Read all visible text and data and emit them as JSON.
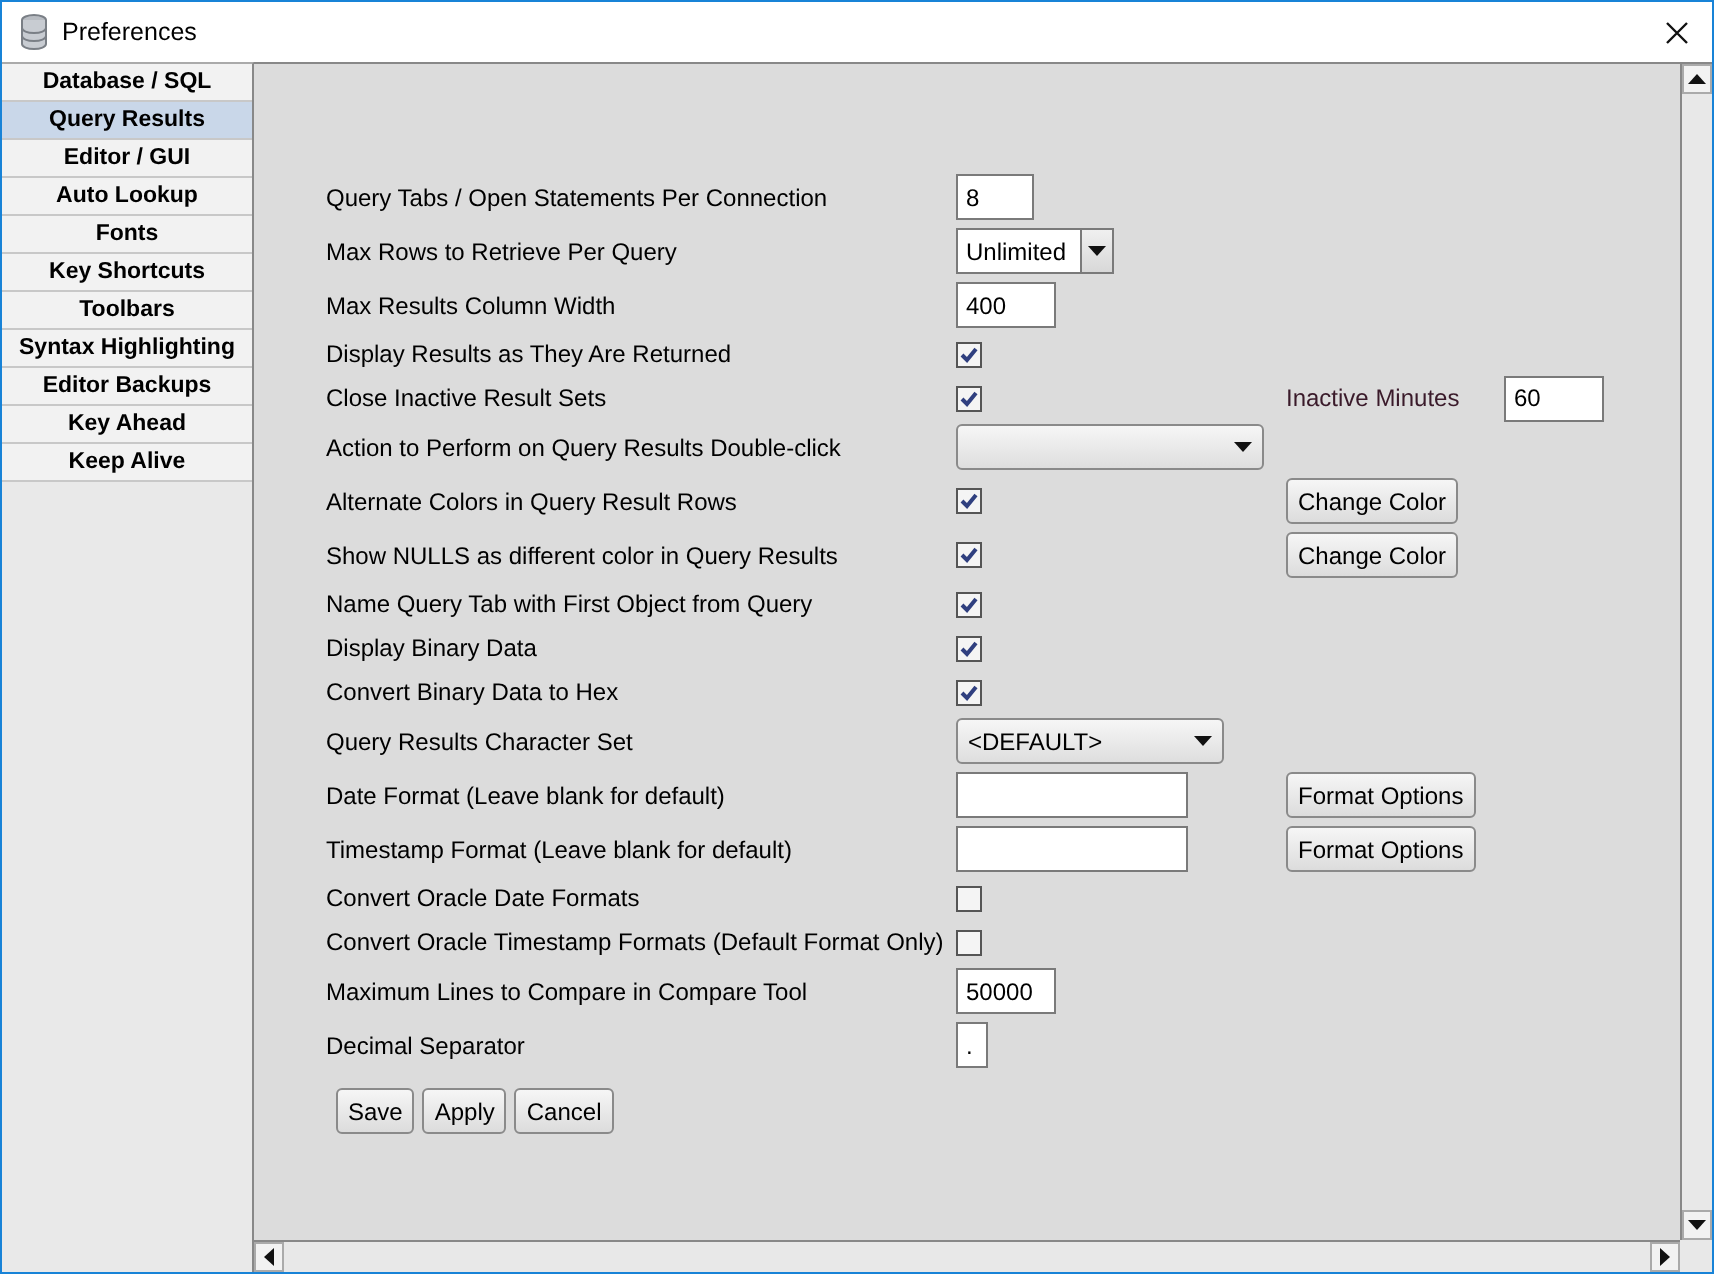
{
  "window": {
    "title": "Preferences"
  },
  "sidebar": {
    "items": [
      {
        "label": "Database / SQL",
        "selected": false
      },
      {
        "label": "Query Results",
        "selected": true
      },
      {
        "label": "Editor / GUI",
        "selected": false
      },
      {
        "label": "Auto Lookup",
        "selected": false
      },
      {
        "label": "Fonts",
        "selected": false
      },
      {
        "label": "Key Shortcuts",
        "selected": false
      },
      {
        "label": "Toolbars",
        "selected": false
      },
      {
        "label": "Syntax Highlighting",
        "selected": false
      },
      {
        "label": "Editor Backups",
        "selected": false
      },
      {
        "label": "Key Ahead",
        "selected": false
      },
      {
        "label": "Keep Alive",
        "selected": false
      }
    ]
  },
  "settings": [
    {
      "label": "Query Tabs / Open Statements Per Connection",
      "kind": "number",
      "value": "8"
    },
    {
      "label": "Max Rows to Retrieve Per Query",
      "kind": "combo",
      "value": "Unlimited"
    },
    {
      "label": "Max Results Column Width",
      "kind": "number",
      "value": "400"
    },
    {
      "label": "Display Results as They Are Returned",
      "kind": "checkbox",
      "checked": true
    },
    {
      "label": "Close Inactive Result Sets",
      "kind": "checkbox",
      "checked": true,
      "extra": {
        "kind": "field",
        "label": "Inactive Minutes",
        "value": "60"
      }
    },
    {
      "label": "Action to Perform on Query Results Double-click",
      "kind": "select"
    },
    {
      "label": "Alternate Colors in Query Result Rows",
      "kind": "checkbox",
      "checked": true,
      "extra": {
        "kind": "button",
        "label": "Change Color"
      }
    },
    {
      "label": "Show NULLS as different color in Query Results",
      "kind": "checkbox",
      "checked": true,
      "extra": {
        "kind": "button",
        "label": "Change Color"
      }
    },
    {
      "label": "Name Query Tab with First Object from Query",
      "kind": "checkbox",
      "checked": true
    },
    {
      "label": "Display Binary Data",
      "kind": "checkbox",
      "checked": true
    },
    {
      "label": "Convert Binary Data to Hex",
      "kind": "checkbox",
      "checked": true
    },
    {
      "label": "Query Results Character Set",
      "kind": "select",
      "value": "<DEFAULT>"
    },
    {
      "label": "Date Format (Leave blank for default)",
      "kind": "text",
      "extra": {
        "kind": "button",
        "label": "Format Options"
      }
    },
    {
      "label": "Timestamp Format (Leave blank for default)",
      "kind": "text",
      "extra": {
        "kind": "button",
        "label": "Format Options"
      }
    },
    {
      "label": "Convert Oracle Date Formats",
      "kind": "checkbox",
      "checked": false
    },
    {
      "label": "Convert Oracle Timestamp Formats (Default Format Only)",
      "kind": "checkbox",
      "checked": false
    },
    {
      "label": "Maximum Lines to Compare in Compare Tool",
      "kind": "number",
      "value": "50000"
    },
    {
      "label": "Decimal Separator",
      "kind": "char",
      "value": "."
    }
  ],
  "buttons": [
    "Save",
    "Apply",
    "Cancel"
  ]
}
